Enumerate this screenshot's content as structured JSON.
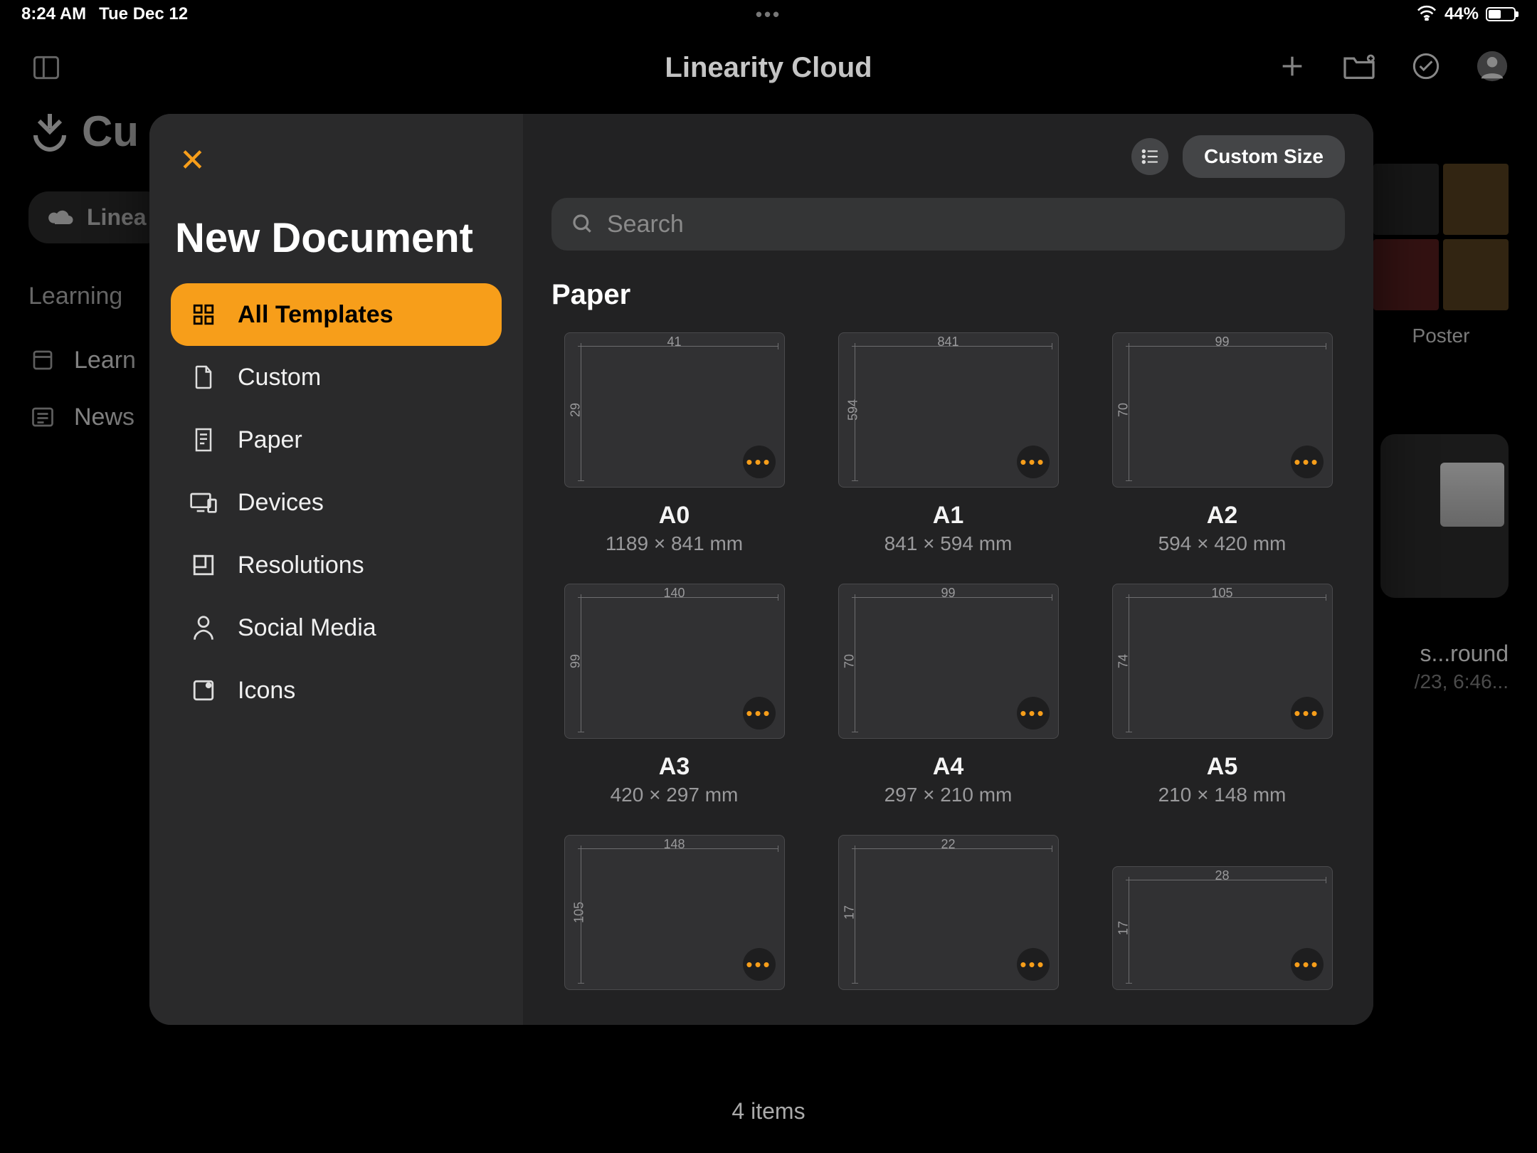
{
  "statusbar": {
    "time": "8:24 AM",
    "date": "Tue Dec 12",
    "battery_pct": "44%"
  },
  "toolbar": {
    "title": "Linearity Cloud"
  },
  "bg": {
    "app_title": "Cu",
    "cloud_pill": "Linea",
    "section": "Learning",
    "learn": "Learn",
    "news": "News",
    "poster_caption": "Poster",
    "round_caption": "s...round",
    "round_sub": "/23, 6:46..."
  },
  "footer": {
    "items": "4 items"
  },
  "modal": {
    "title": "New Document",
    "custom_size": "Custom Size",
    "search_placeholder": "Search",
    "section": "Paper",
    "categories": [
      {
        "label": "All Templates",
        "active": true
      },
      {
        "label": "Custom"
      },
      {
        "label": "Paper"
      },
      {
        "label": "Devices"
      },
      {
        "label": "Resolutions"
      },
      {
        "label": "Social Media"
      },
      {
        "label": "Icons"
      }
    ],
    "templates": [
      {
        "name": "A0",
        "dim": "1189 × 841 mm",
        "w": "41",
        "h": "29"
      },
      {
        "name": "A1",
        "dim": "841 × 594 mm",
        "w": "841",
        "h": "594"
      },
      {
        "name": "A2",
        "dim": "594 × 420 mm",
        "w": "99",
        "h": "70"
      },
      {
        "name": "A3",
        "dim": "420 × 297 mm",
        "w": "140",
        "h": "99"
      },
      {
        "name": "A4",
        "dim": "297 × 210 mm",
        "w": "99",
        "h": "70"
      },
      {
        "name": "A5",
        "dim": "210 × 148 mm",
        "w": "105",
        "h": "74"
      },
      {
        "name": "",
        "dim": "",
        "w": "148",
        "h": "105",
        "short": false
      },
      {
        "name": "",
        "dim": "",
        "w": "22",
        "h": "17",
        "short": false
      },
      {
        "name": "",
        "dim": "",
        "w": "28",
        "h": "17",
        "short": true
      }
    ]
  }
}
